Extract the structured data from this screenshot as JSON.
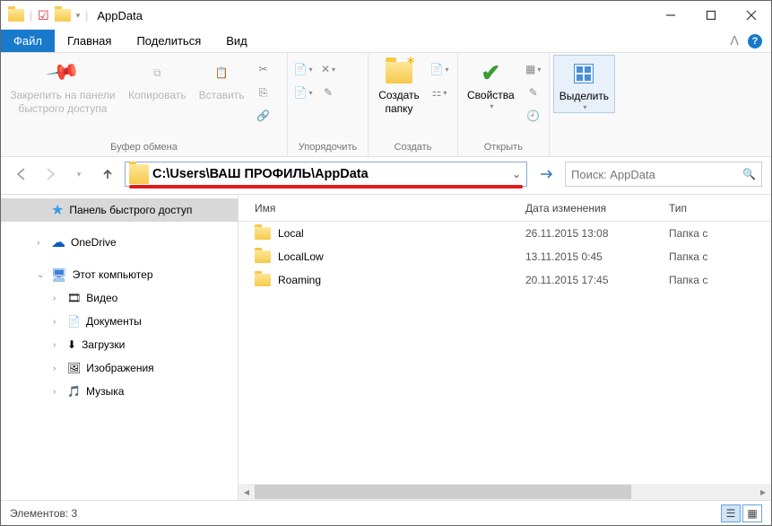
{
  "window_title": "AppData",
  "tabs": {
    "file": "Файл",
    "home": "Главная",
    "share": "Поделиться",
    "view": "Вид"
  },
  "ribbon": {
    "clipboard": {
      "pin": "Закрепить на панели\nбыстрого доступа",
      "copy": "Копировать",
      "paste": "Вставить",
      "label": "Буфер обмена"
    },
    "organize": {
      "label": "Упорядочить"
    },
    "new": {
      "new_folder": "Создать\nпапку",
      "label": "Создать"
    },
    "open": {
      "properties": "Свойства",
      "label": "Открыть"
    },
    "select": {
      "select": "Выделить"
    }
  },
  "address_path": "C:\\Users\\ВАШ ПРОФИЛЬ\\AppData",
  "search_placeholder": "Поиск: AppData",
  "tree": {
    "quick_access": "Панель быстрого доступ",
    "onedrive": "OneDrive",
    "this_pc": "Этот компьютер",
    "videos": "Видео",
    "documents": "Документы",
    "downloads": "Загрузки",
    "pictures": "Изображения",
    "music": "Музыка"
  },
  "columns": {
    "name": "Имя",
    "date": "Дата изменения",
    "type": "Тип"
  },
  "rows": [
    {
      "name": "Local",
      "date": "26.11.2015 13:08",
      "type": "Папка с"
    },
    {
      "name": "LocalLow",
      "date": "13.11.2015 0:45",
      "type": "Папка с"
    },
    {
      "name": "Roaming",
      "date": "20.11.2015 17:45",
      "type": "Папка с"
    }
  ],
  "status_text": "Элементов: 3"
}
